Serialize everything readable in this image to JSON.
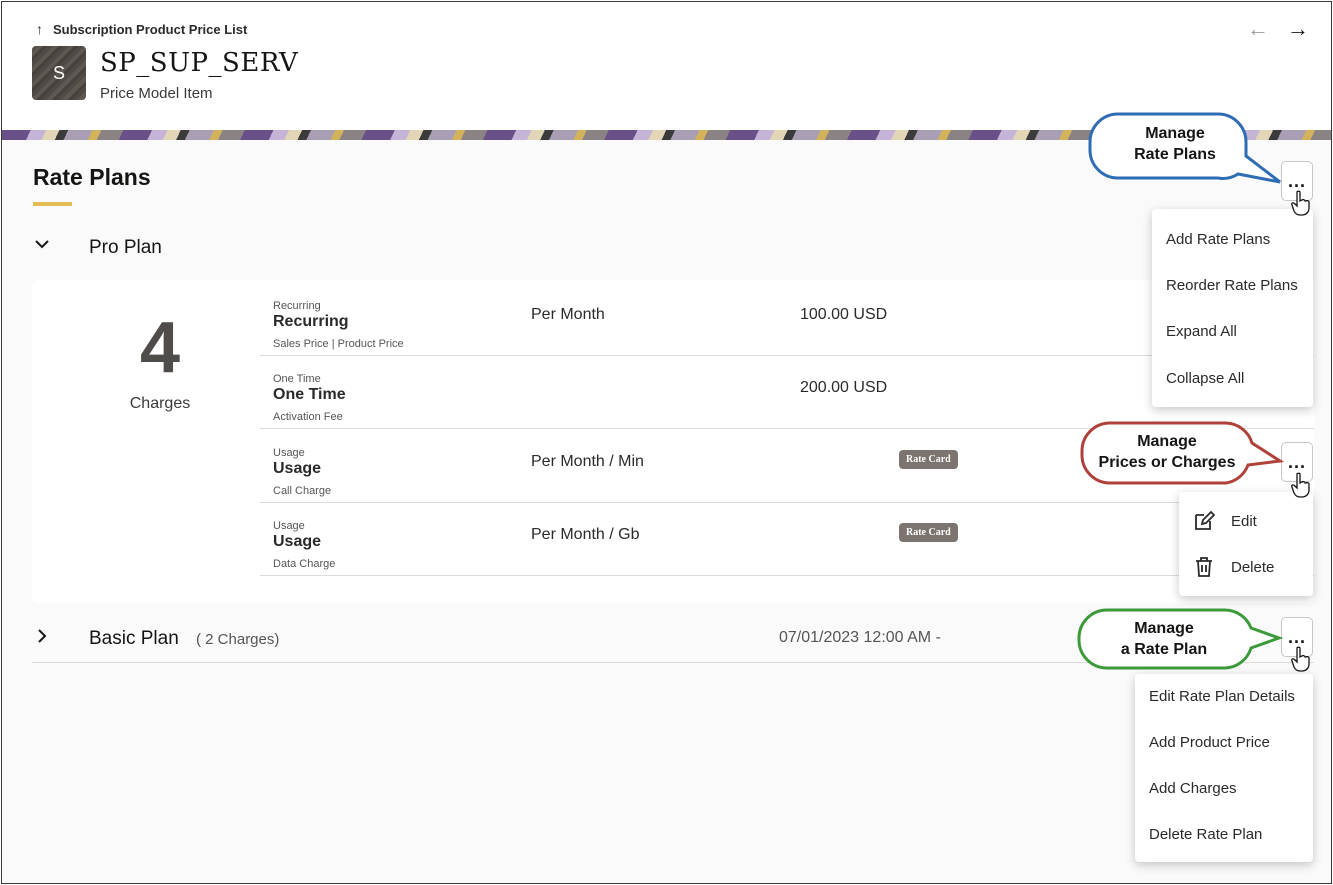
{
  "header": {
    "breadcrumb": "Subscription Product Price List",
    "avatar_letter": "S",
    "title": "SP_SUP_SERV",
    "subtitle": "Price Model Item"
  },
  "section": {
    "title": "Rate Plans"
  },
  "menu_button_label": "...",
  "pro_plan": {
    "name": "Pro Plan",
    "charge_count": "4",
    "charges_label": "Charges",
    "charges": [
      {
        "kind": "Recurring",
        "kind_bold": "Recurring",
        "desc": "Sales Price | Product Price",
        "period": "Per Month",
        "amount": "100.00 USD",
        "badge": ""
      },
      {
        "kind": "One Time",
        "kind_bold": "One Time",
        "desc": "Activation Fee",
        "period": "",
        "amount": "200.00 USD",
        "badge": ""
      },
      {
        "kind": "Usage",
        "kind_bold": "Usage",
        "desc": "Call Charge",
        "period": "Per Month / Min",
        "amount": "",
        "badge": "Rate Card"
      },
      {
        "kind": "Usage",
        "kind_bold": "Usage",
        "desc": "Data Charge",
        "period": "Per Month / Gb",
        "amount": "",
        "badge": "Rate Card"
      }
    ]
  },
  "basic_plan": {
    "name": "Basic Plan",
    "charges_text": "( 2 Charges)",
    "date": "07/01/2023 12:00 AM -"
  },
  "rate_plans_menu": {
    "items": [
      "Add Rate Plans",
      "Reorder Rate Plans",
      "Expand All",
      "Collapse All"
    ]
  },
  "charge_menu": {
    "items": [
      "Edit",
      "Delete"
    ]
  },
  "rate_plan_menu": {
    "items": [
      "Edit Rate Plan Details",
      "Add Product Price",
      "Add Charges",
      "Delete Rate Plan"
    ]
  },
  "callouts": {
    "rate_plans": {
      "line1": "Manage",
      "line2": "Rate Plans",
      "color": "#2e6db4"
    },
    "charges": {
      "line1": "Manage",
      "line2": "Prices or Charges",
      "color": "#b0413a"
    },
    "rate_plan": {
      "line1": "Manage",
      "line2": "a Rate Plan",
      "color": "#3c9a3a"
    }
  },
  "colors": {
    "accent_underline": "#e3be54",
    "badge_bg": "#7b7470"
  }
}
